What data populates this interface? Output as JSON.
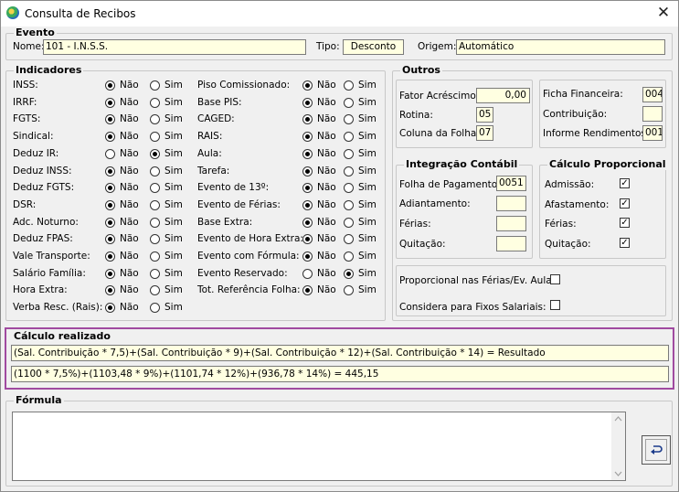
{
  "window": {
    "title": "Consulta de Recibos",
    "close": "✕"
  },
  "evento": {
    "legend": "Evento",
    "nome_label": "Nome:",
    "nome_value": "101 - I.N.S.S.",
    "tipo_label": "Tipo:",
    "tipo_value": "Desconto",
    "origem_label": "Origem:",
    "origem_value": "Automático"
  },
  "indicadores": {
    "legend": "Indicadores",
    "nao": "Não",
    "sim": "Sim",
    "left": [
      {
        "label": "INSS:",
        "value": "nao"
      },
      {
        "label": "IRRF:",
        "value": "nao"
      },
      {
        "label": "FGTS:",
        "value": "nao"
      },
      {
        "label": "Sindical:",
        "value": "nao"
      },
      {
        "label": "Deduz IR:",
        "value": "sim"
      },
      {
        "label": "Deduz INSS:",
        "value": "nao"
      },
      {
        "label": "Deduz FGTS:",
        "value": "nao"
      },
      {
        "label": "DSR:",
        "value": "nao"
      },
      {
        "label": "Adc. Noturno:",
        "value": "nao"
      },
      {
        "label": "Deduz FPAS:",
        "value": "nao"
      },
      {
        "label": "Vale Transporte:",
        "value": "nao"
      },
      {
        "label": "Salário Família:",
        "value": "nao"
      },
      {
        "label": "Hora Extra:",
        "value": "nao"
      },
      {
        "label": "Verba Resc. (Rais):",
        "value": "nao"
      }
    ],
    "right": [
      {
        "label": "Piso Comissionado:",
        "value": "nao"
      },
      {
        "label": "Base PIS:",
        "value": "nao"
      },
      {
        "label": "CAGED:",
        "value": "nao"
      },
      {
        "label": "RAIS:",
        "value": "nao"
      },
      {
        "label": "Aula:",
        "value": "nao"
      },
      {
        "label": "Tarefa:",
        "value": "nao"
      },
      {
        "label": "Evento de 13º:",
        "value": "nao"
      },
      {
        "label": "Evento de Férias:",
        "value": "nao"
      },
      {
        "label": "Base Extra:",
        "value": "nao"
      },
      {
        "label": "Evento de Hora Extra:",
        "value": "nao"
      },
      {
        "label": "Evento com Fórmula:",
        "value": "nao"
      },
      {
        "label": "Evento Reservado:",
        "value": "sim"
      },
      {
        "label": "Tot. Referência Folha:",
        "value": "nao"
      }
    ]
  },
  "outros": {
    "legend": "Outros",
    "fator_label": "Fator Acréscimo:",
    "fator_value": "0,00",
    "rotina_label": "Rotina:",
    "rotina_value": "05",
    "coluna_label": "Coluna da Folha:",
    "coluna_value": "07",
    "ficha_label": "Ficha Financeira:",
    "ficha_value": "004",
    "contribuicao_label": "Contribuição:",
    "contribuicao_value": "",
    "informe_label": "Informe Rendimentos:",
    "informe_value": "001"
  },
  "integracao": {
    "legend": "Integração Contábil",
    "folha_label": "Folha de Pagamento:",
    "folha_value": "0051",
    "adiantamento_label": "Adiantamento:",
    "adiantamento_value": "",
    "ferias_label": "Férias:",
    "ferias_value": "",
    "quitacao_label": "Quitação:",
    "quitacao_value": ""
  },
  "proporcional": {
    "legend": "Cálculo Proporcional",
    "admissao_label": "Admissão:",
    "admissao": true,
    "afastamento_label": "Afastamento:",
    "afastamento": true,
    "ferias_label": "Férias:",
    "ferias": true,
    "quitacao_label": "Quitação:",
    "quitacao": true
  },
  "extras": {
    "prop_ferias_label": "Proporcional nas Férias/Ev. Aula:",
    "prop_ferias": false,
    "fixos_label": "Considera para Fixos Salariais:",
    "fixos": false
  },
  "calculo": {
    "legend": "Cálculo realizado",
    "line1": "(Sal. Contribuição * 7,5)+(Sal. Contribuição * 9)+(Sal. Contribuição * 12)+(Sal. Contribuição * 14) = Resultado",
    "line2": "(1100 * 7,5%)+(1103,48 * 9%)+(1101,74 * 12%)+(936,78 * 14%) = 445,15"
  },
  "formula": {
    "legend": "Fórmula",
    "value": ""
  },
  "icons": {
    "undo": "undo-icon",
    "check_glyph": "✓"
  }
}
